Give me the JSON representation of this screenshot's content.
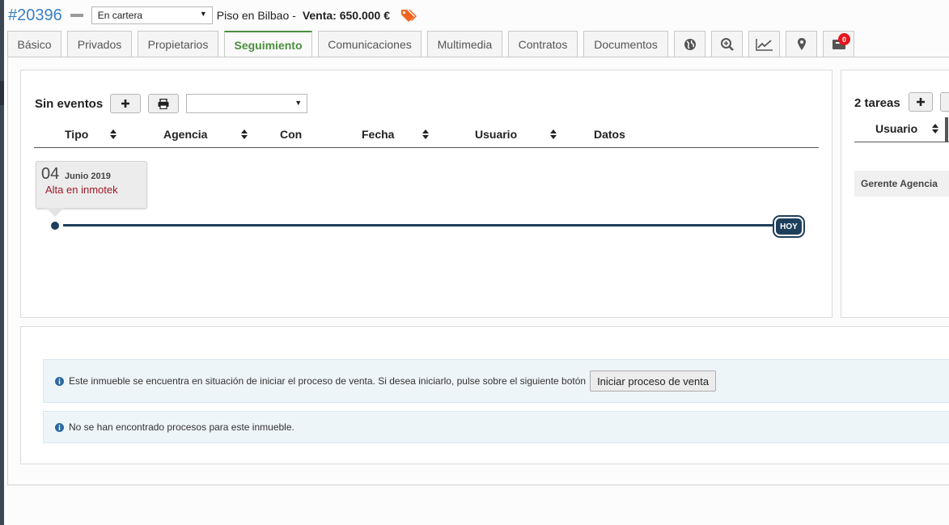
{
  "header": {
    "ref_number": "#20396",
    "status": "En cartera",
    "title": "Piso en Bilbao -",
    "price": "Venta: 650.000 €"
  },
  "tabs": [
    {
      "label": "Básico"
    },
    {
      "label": "Privados"
    },
    {
      "label": "Propietarios"
    },
    {
      "label": "Seguimiento",
      "active": true
    },
    {
      "label": "Comunicaciones"
    },
    {
      "label": "Multimedia"
    },
    {
      "label": "Contratos"
    },
    {
      "label": "Documentos"
    }
  ],
  "icon_tabs": [
    {
      "icon": "globe-icon"
    },
    {
      "icon": "zoom-in-icon"
    },
    {
      "icon": "chart-line-icon"
    },
    {
      "icon": "map-marker-icon"
    },
    {
      "icon": "inbox-icon",
      "badge": "0"
    }
  ],
  "events": {
    "title": "Sin eventos",
    "columns": [
      "Tipo",
      "Agencia",
      "Con",
      "Fecha",
      "Usuario",
      "Datos"
    ],
    "timeline": [
      {
        "day": "04",
        "month": "Junio 2019",
        "description": "Alta en inmotek"
      }
    ],
    "today_label": "HOY"
  },
  "tasks": {
    "title": "2 tareas",
    "columns": [
      "Usuario"
    ],
    "rows": [
      "Gerente Agencia"
    ]
  },
  "process": {
    "sale_message": "Este inmueble se encuentra en situación de iniciar el proceso de venta. Si desea iniciarlo, pulse sobre el siguiente botón",
    "sale_button": "Iniciar proceso de venta",
    "no_process_message": "No se han encontrado procesos para este inmueble."
  },
  "colors": {
    "accent_green": "#4a8f3f",
    "timeline_navy": "#1e3f5c",
    "event_red": "#a0192b",
    "link_blue": "#3a7fc1",
    "badge_red": "#e8141b"
  }
}
